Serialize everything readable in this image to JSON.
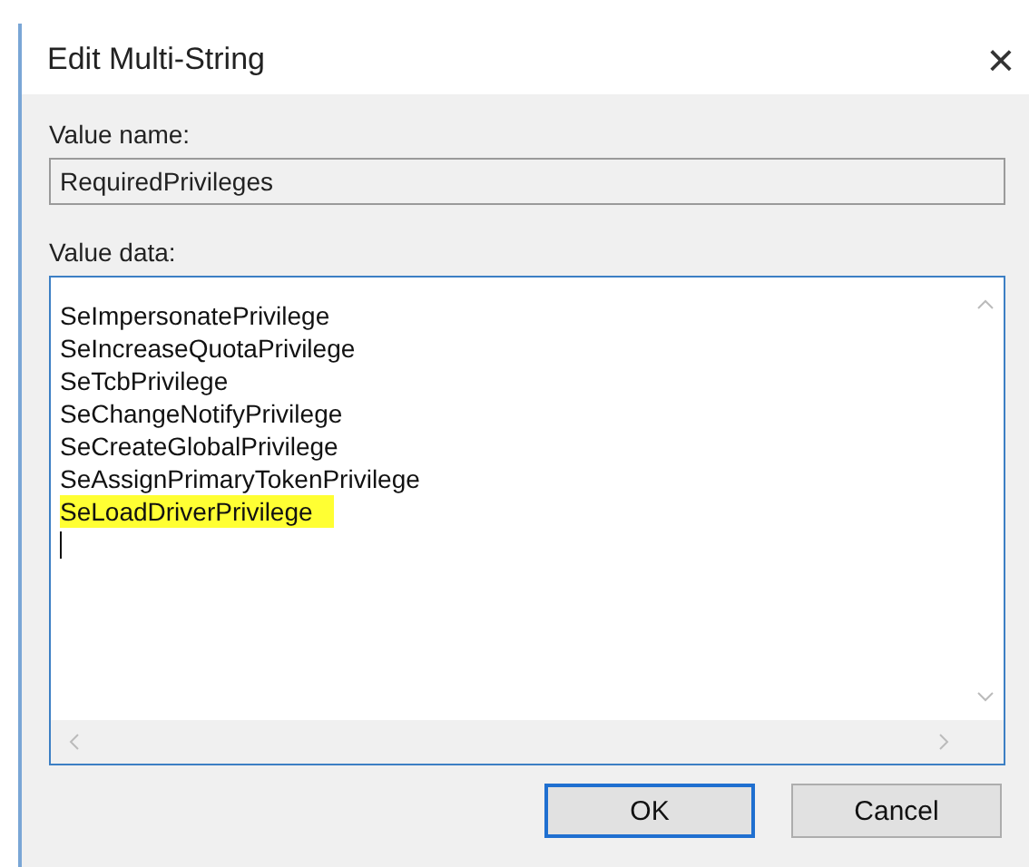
{
  "window": {
    "title": "Edit Multi-String",
    "close": "×"
  },
  "value_name": {
    "label": "Value name:",
    "value": "RequiredPrivileges",
    "disabled": true
  },
  "value_data": {
    "label": "Value data:",
    "focused": true,
    "lines": [
      {
        "text": "SeImpersonatePrivilege",
        "highlighted": false
      },
      {
        "text": "SeIncreaseQuotaPrivilege",
        "highlighted": false
      },
      {
        "text": "SeTcbPrivilege",
        "highlighted": false
      },
      {
        "text": "SeChangeNotifyPrivilege",
        "highlighted": false
      },
      {
        "text": "SeCreateGlobalPrivilege",
        "highlighted": false
      },
      {
        "text": "SeAssignPrimaryTokenPrivilege",
        "highlighted": false
      },
      {
        "text": "SeLoadDriverPrivilege",
        "highlighted": true
      }
    ]
  },
  "buttons": [
    {
      "label": "OK",
      "default": true
    },
    {
      "label": "Cancel",
      "default": false
    }
  ]
}
